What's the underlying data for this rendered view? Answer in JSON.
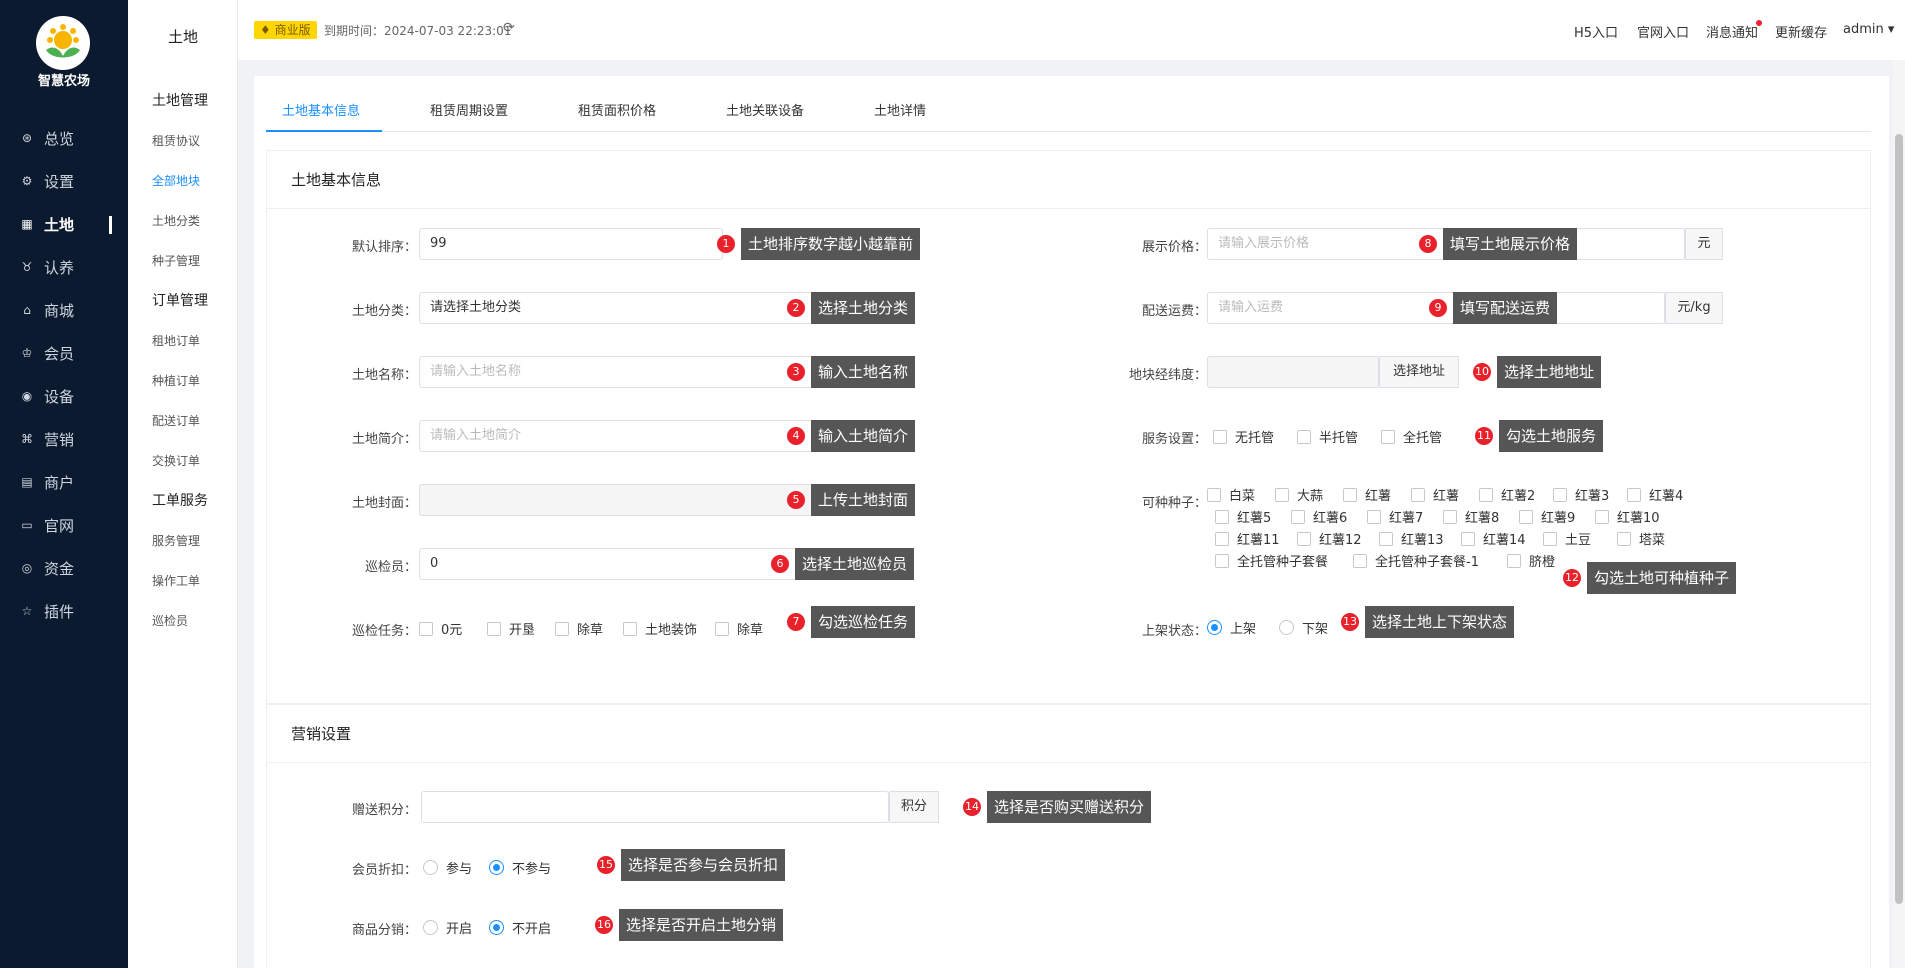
{
  "app": {
    "name": "智慧农场"
  },
  "nav": [
    {
      "label": "总览",
      "icon": "dashboard-icon"
    },
    {
      "label": "设置",
      "icon": "gear-icon"
    },
    {
      "label": "土地",
      "icon": "grid-icon",
      "active": true
    },
    {
      "label": "认养",
      "icon": "adopt-icon"
    },
    {
      "label": "商城",
      "icon": "shop-icon"
    },
    {
      "label": "会员",
      "icon": "member-icon"
    },
    {
      "label": "设备",
      "icon": "device-icon"
    },
    {
      "label": "营销",
      "icon": "marketing-icon"
    },
    {
      "label": "商户",
      "icon": "merchant-icon"
    },
    {
      "label": "官网",
      "icon": "website-icon"
    },
    {
      "label": "资金",
      "icon": "money-icon"
    },
    {
      "label": "插件",
      "icon": "star-icon"
    }
  ],
  "subnav": {
    "title": "土地",
    "groups": [
      "土地管理",
      "订单管理",
      "工单服务"
    ],
    "items": [
      "租赁协议",
      "全部地块",
      "土地分类",
      "种子管理",
      "租地订单",
      "种植订单",
      "配送订单",
      "交换订单",
      "服务管理",
      "操作工单",
      "巡检员"
    ],
    "active": "全部地块"
  },
  "header": {
    "badge": "商业版",
    "expire": "到期时间：2024-07-03 22:23:01",
    "links": [
      "H5入口",
      "官网入口",
      "消息通知",
      "更新缓存",
      "admin"
    ]
  },
  "tabs": [
    "土地基本信息",
    "租赁周期设置",
    "租赁面积价格",
    "土地关联设备",
    "土地详情"
  ],
  "basic": {
    "title": "土地基本信息",
    "sort_label": "默认排序：",
    "sort_value": "99",
    "category_label": "土地分类：",
    "category_value": "请选择土地分类",
    "name_label": "土地名称：",
    "name_placeholder": "请输入土地名称",
    "intro_label": "土地简介：",
    "intro_placeholder": "请输入土地简介",
    "cover_label": "土地封面：",
    "inspector_label": "巡检员：",
    "inspector_value": "0",
    "task_label": "巡检任务：",
    "tasks": [
      "0元",
      "开垦",
      "除草",
      "土地装饰",
      "除草"
    ],
    "price_label": "展示价格：",
    "price_placeholder": "请输入展示价格",
    "price_unit": "元",
    "freight_label": "配送运费：",
    "freight_placeholder": "请输入运费",
    "freight_unit": "元/kg",
    "geo_label": "地块经纬度：",
    "geo_button": "选择地址",
    "service_label": "服务设置：",
    "services": [
      "无托管",
      "半托管",
      "全托管"
    ],
    "seeds_label": "可种种子：",
    "seeds_rows": [
      [
        "白菜",
        "大蒜",
        "红薯",
        "红薯",
        "红薯2",
        "红薯3",
        "红薯4"
      ],
      [
        "红薯5",
        "红薯6",
        "红薯7",
        "红薯8",
        "红薯9",
        "红薯10"
      ],
      [
        "红薯11",
        "红薯12",
        "红薯13",
        "红薯14",
        "土豆",
        "塔菜"
      ],
      [
        "全托管种子套餐",
        "全托管种子套餐-1",
        "脐橙"
      ]
    ],
    "status_label": "上架状态：",
    "status_options": [
      "上架",
      "下架"
    ],
    "status_selected": "上架"
  },
  "marketing": {
    "title": "营销设置",
    "points_label": "赠送积分：",
    "points_unit": "积分",
    "member_label": "会员折扣：",
    "member_options": [
      "参与",
      "不参与"
    ],
    "member_selected": "不参与",
    "dist_label": "商品分销：",
    "dist_options": [
      "开启",
      "不开启"
    ],
    "dist_selected": "不开启"
  },
  "annotations": [
    {
      "num": "1",
      "text": "土地排序数字越小越靠前"
    },
    {
      "num": "2",
      "text": "选择土地分类"
    },
    {
      "num": "3",
      "text": "输入土地名称"
    },
    {
      "num": "4",
      "text": "输入土地简介"
    },
    {
      "num": "5",
      "text": "上传土地封面"
    },
    {
      "num": "6",
      "text": "选择土地巡检员"
    },
    {
      "num": "7",
      "text": "勾选巡检任务"
    },
    {
      "num": "8",
      "text": "填写土地展示价格"
    },
    {
      "num": "9",
      "text": "填写配送运费"
    },
    {
      "num": "10",
      "text": "选择土地地址"
    },
    {
      "num": "11",
      "text": "勾选土地服务"
    },
    {
      "num": "12",
      "text": "勾选土地可种植种子"
    },
    {
      "num": "13",
      "text": "选择土地上下架状态"
    },
    {
      "num": "14",
      "text": "选择是否购买赠送积分"
    },
    {
      "num": "15",
      "text": "选择是否参与会员折扣"
    },
    {
      "num": "16",
      "text": "选择是否开启土地分销"
    }
  ]
}
